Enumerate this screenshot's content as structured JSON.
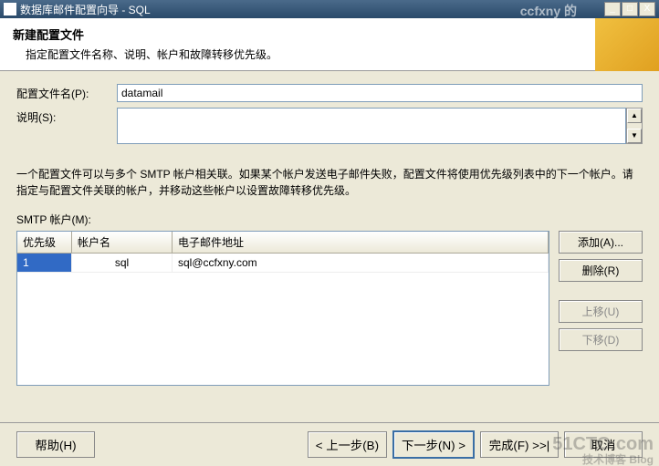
{
  "titlebar": {
    "title": "数据库邮件配置向导 - SQL",
    "overlay": "ccfxny 的",
    "min": "_",
    "max": "□",
    "close": "X"
  },
  "header": {
    "title": "新建配置文件",
    "subtitle": "指定配置文件名称、说明、帐户和故障转移优先级。"
  },
  "form": {
    "profile_label": "配置文件名(P):",
    "profile_value": "datamail",
    "desc_label": "说明(S):",
    "desc_value": ""
  },
  "info": "一个配置文件可以与多个 SMTP 帐户相关联。如果某个帐户发送电子邮件失败，配置文件将使用优先级列表中的下一个帐户。请指定与配置文件关联的帐户，并移动这些帐户以设置故障转移优先级。",
  "smtp": {
    "section_label": "SMTP 帐户(M):",
    "columns": {
      "priority": "优先级",
      "account": "帐户名",
      "email": "电子邮件地址"
    },
    "rows": [
      {
        "priority": "1",
        "account": "sql",
        "email": "sql@ccfxny.com"
      }
    ]
  },
  "side": {
    "add": "添加(A)...",
    "remove": "删除(R)",
    "up": "上移(U)",
    "down": "下移(D)"
  },
  "nav": {
    "help": "帮助(H)",
    "back": "< 上一步(B)",
    "next": "下一步(N) >",
    "finish": "完成(F) >>|",
    "cancel": "取消"
  },
  "watermark": {
    "main": "51CTO.com",
    "sub": "技术博客  Blog"
  },
  "scroll": {
    "up": "▲",
    "down": "▼"
  }
}
